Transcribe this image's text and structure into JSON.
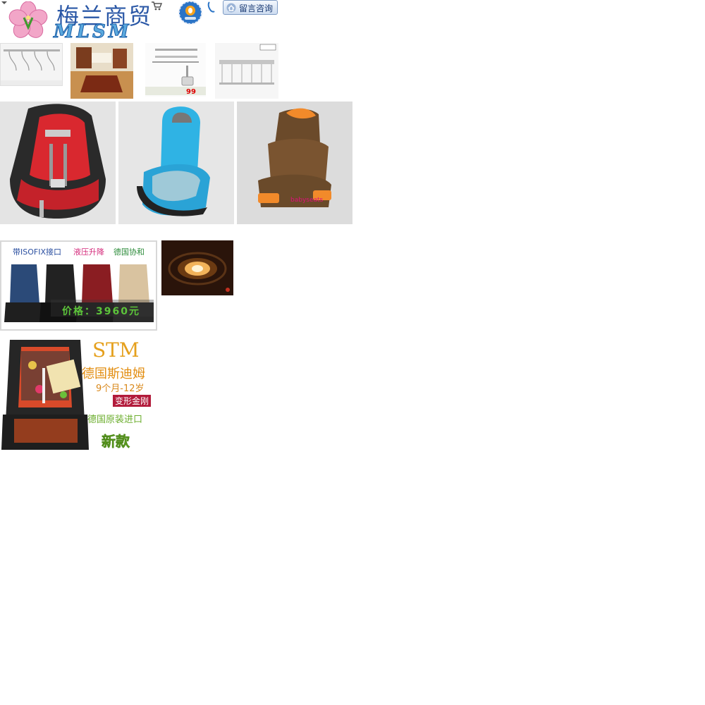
{
  "header": {
    "logo_cn": "梅兰商贸",
    "logo_en": "MLSM",
    "message_button_label": "留言咨询",
    "icons": [
      "dropdown-arrow-icon",
      "flower-logo-icon",
      "cart-icon",
      "qq-icon",
      "phone-icon",
      "house-icon"
    ]
  },
  "products_small": [
    {
      "name": "clothes-drying-rack"
    },
    {
      "name": "wooden-floor-room"
    },
    {
      "name": "towel-rack",
      "price_tag": "99"
    },
    {
      "name": "ceiling-drying-rack"
    }
  ],
  "products_seats": [
    {
      "name": "red-car-seat"
    },
    {
      "name": "blue-booster-seat"
    },
    {
      "name": "brown-booster-seat",
      "caption": "babyseats"
    }
  ],
  "banner_isofix": {
    "feature_1": "带ISOFIX接口",
    "feature_2": "液压升降",
    "feature_3": "德国协和",
    "price": "价格：3960元"
  },
  "banner_stm": {
    "brand_en": "STM",
    "brand_cn": "德国斯迪姆",
    "age_range": "9个月-12岁",
    "tag": "变形金刚",
    "origin": "德国原装进口",
    "new_label": "新款"
  },
  "colors": {
    "logo_blue": "#2a57a6",
    "stm_orange": "#e5a01d",
    "tag_red": "#b21b3b",
    "price_green": "#5cc43a"
  }
}
